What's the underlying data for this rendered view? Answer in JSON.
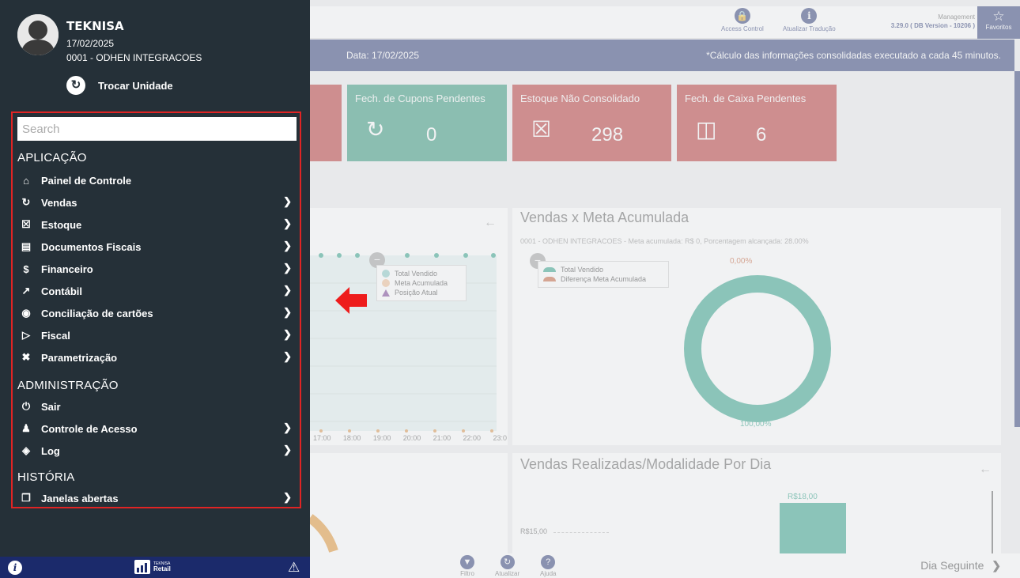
{
  "topbar": {
    "access_control": "Access Control",
    "update_translation": "Atualizar Tradução",
    "management": "Management",
    "version": "3.29.0 ( DB Version - 10206 )",
    "favorites": "Favoritos"
  },
  "infobar": {
    "date": "Data: 17/02/2025",
    "note": "*Cálculo das informações consolidadas executado a cada 45 minutos."
  },
  "cards": [
    {
      "title": "",
      "value": "",
      "color": "#b22222"
    },
    {
      "title": "Fech. de Cupons Pendentes",
      "value": "0",
      "color": "#1e8c6e"
    },
    {
      "title": "Estoque Não Consolidado",
      "value": "298",
      "color": "#b22222"
    },
    {
      "title": "Fech. de Caixa Pendentes",
      "value": "6",
      "color": "#b22222"
    }
  ],
  "line_chart": {
    "legend": [
      "Total Vendido",
      "Meta Acumulada",
      "Posição Atual"
    ],
    "x_ticks": [
      "17:00",
      "18:00",
      "19:00",
      "20:00",
      "21:00",
      "22:00",
      "23:0"
    ]
  },
  "donut": {
    "title": "Vendas x Meta Acumulada",
    "subtitle": "0001 - ODHEN INTEGRACOES - Meta acumulada: R$ 0, Porcentagem alcançada: 28.00%",
    "legend": [
      "Total Vendido",
      "Diferença Meta Acumulada"
    ],
    "top_label": "0,00%",
    "bottom_label": "100,00%",
    "accent": "#1e9a7e"
  },
  "bar_chart": {
    "title": "Vendas Realizadas/Modalidade Por Dia",
    "bar_label": "R$18,00",
    "tick_label": "R$15,00"
  },
  "bottom": {
    "filter": "Filtro",
    "refresh": "Atualizar",
    "help": "Ajuda",
    "next_day": "Dia Seguinte"
  },
  "sidebar": {
    "user_name": "TEKNISA",
    "date": "17/02/2025",
    "unit": "0001 - ODHEN INTEGRACOES",
    "swap_unit": "Trocar Unidade",
    "search_placeholder": "Search",
    "sections": [
      {
        "label": "APLICAÇÃO",
        "items": [
          {
            "label": "Painel de Controle",
            "icon": "home-icon",
            "chevron": false
          },
          {
            "label": "Vendas",
            "icon": "sales-icon",
            "chevron": true
          },
          {
            "label": "Estoque",
            "icon": "stock-icon",
            "chevron": true
          },
          {
            "label": "Documentos Fiscais",
            "icon": "documents-icon",
            "chevron": true
          },
          {
            "label": "Financeiro",
            "icon": "dollar-icon",
            "chevron": true
          },
          {
            "label": "Contábil",
            "icon": "chart-icon",
            "chevron": true
          },
          {
            "label": "Conciliação de cartões",
            "icon": "bag-icon",
            "chevron": true
          },
          {
            "label": "Fiscal",
            "icon": "fiscal-icon",
            "chevron": true
          },
          {
            "label": "Parametrização",
            "icon": "tools-icon",
            "chevron": true
          }
        ]
      },
      {
        "label": "ADMINISTRAÇÃO",
        "items": [
          {
            "label": "Sair",
            "icon": "power-icon",
            "chevron": false
          },
          {
            "label": "Controle de Acesso",
            "icon": "user-icon",
            "chevron": true
          },
          {
            "label": "Log",
            "icon": "layers-icon",
            "chevron": true
          }
        ]
      },
      {
        "label": "HISTÓRIA",
        "items": [
          {
            "label": "Janelas abertas",
            "icon": "windows-icon",
            "chevron": true
          }
        ]
      }
    ],
    "logo_small": "TEKNISA",
    "logo_text": "Retail"
  }
}
